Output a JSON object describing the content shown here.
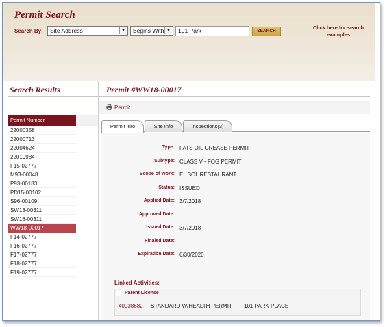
{
  "header": {
    "title": "Permit Search",
    "search_by_label": "Search By:",
    "search_field_select": "Site Address",
    "match_type_select": "Begins With",
    "search_value": "101 Park",
    "search_button": "SEARCH",
    "examples_link": "Click here for search examples"
  },
  "results": {
    "title": "Search Results",
    "column_header": "Permit Number",
    "items": [
      "22000358",
      "22000713",
      "22004624",
      "22019984",
      "F15-02777",
      "M93-00048",
      "P93-00183",
      "PD15-00102",
      "S96-00109",
      "SW13-00311",
      "SW16-00311",
      "WW18-00017",
      "F14-02777",
      "F16-02777",
      "F17-02777",
      "F18-02777",
      "F19-02777"
    ],
    "selected_index": 11
  },
  "permit": {
    "title": "Permit #WW18-00017",
    "print_label": "Permit",
    "tabs": [
      {
        "label": "Permit Info",
        "active": true
      },
      {
        "label": "Site Info",
        "active": false
      },
      {
        "label": "Inspections(3)",
        "active": false
      }
    ],
    "fields": [
      {
        "label": "Type:",
        "value": "FATS OIL GREASE PERMIT"
      },
      {
        "label": "Subtype:",
        "value": "CLASS V - FOG PERMIT"
      },
      {
        "label": "Scope of Work:",
        "value": "EL SOL RESTAURANT"
      },
      {
        "label": "Status:",
        "value": "ISSUED"
      },
      {
        "label": "Applied Date:",
        "value": "3/7/2018"
      },
      {
        "label": "Approved Date:",
        "value": ""
      },
      {
        "label": "Issued Date:",
        "value": "3/7/2018"
      },
      {
        "label": "Finaled Date:",
        "value": ""
      },
      {
        "label": "Expiration Date:",
        "value": "6/30/2020"
      }
    ],
    "linked_title": "Linked Activities:",
    "parent_label": "Parent License",
    "collapse_symbol": "−",
    "activity": {
      "number": "40038682",
      "type": "STANDARD W/HEALTH PERMIT",
      "address": "101 PARK PLACE"
    }
  },
  "colors": {
    "brand": "#7b1620",
    "selected_row": "#b8454d",
    "header_bg": "#e9dfcb"
  },
  "icons": {
    "dropdown": "chevron-down-icon",
    "print": "printer-icon",
    "collapse": "minus-box-icon"
  }
}
